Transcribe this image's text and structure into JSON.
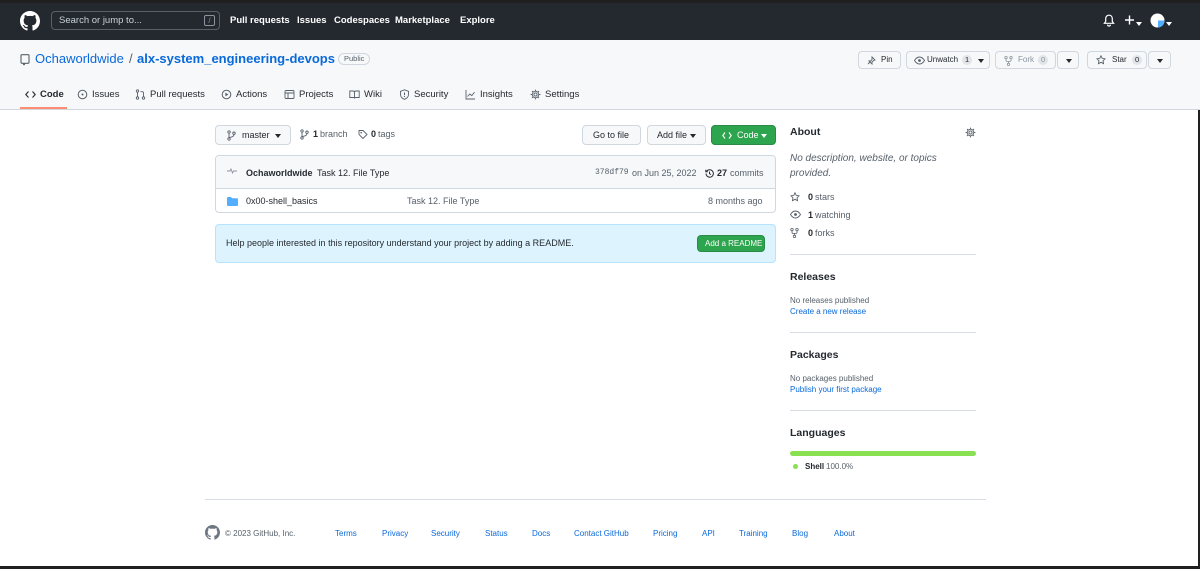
{
  "header": {
    "search_placeholder": "Search or jump to...",
    "slash_hint": "/",
    "nav": [
      "Pull requests",
      "Issues",
      "Codespaces",
      "Marketplace",
      "Explore"
    ],
    "plus_label": "+",
    "icons": [
      "github-logo",
      "bell-icon",
      "plus-icon",
      "avatar"
    ]
  },
  "repo": {
    "owner": "Ochaworldwide",
    "separator": "/",
    "name": "alx-system_engineering-devops",
    "visibility": "Public",
    "pin_label": "Pin",
    "unwatch_label": "Unwatch",
    "watch_count": "1",
    "fork_label": "Fork",
    "fork_count": "0",
    "star_label": "Star",
    "star_count": "0"
  },
  "tabs": [
    {
      "label": "Code",
      "icon": "code-icon",
      "selected": true
    },
    {
      "label": "Issues",
      "icon": "issue-icon"
    },
    {
      "label": "Pull requests",
      "icon": "pull-request-icon"
    },
    {
      "label": "Actions",
      "icon": "play-icon"
    },
    {
      "label": "Projects",
      "icon": "table-icon"
    },
    {
      "label": "Wiki",
      "icon": "book-icon"
    },
    {
      "label": "Security",
      "icon": "shield-icon"
    },
    {
      "label": "Insights",
      "icon": "graph-icon"
    },
    {
      "label": "Settings",
      "icon": "gear-icon"
    }
  ],
  "toolbar": {
    "branch": "master",
    "branch_count": "1",
    "branch_word": "branch",
    "tag_count": "0",
    "tag_word": "tags",
    "goto_file": "Go to file",
    "add_file": "Add file",
    "code": "Code"
  },
  "commit": {
    "author": "Ochaworldwide",
    "message": "Task 12. File Type",
    "sha": "378df79",
    "date": "on Jun 25, 2022",
    "count": "27",
    "count_word": "commits"
  },
  "files": [
    {
      "name": "0x00-shell_basics",
      "message": "Task 12. File Type",
      "age": "8 months ago",
      "type": "folder"
    }
  ],
  "readme_banner": {
    "text": "Help people interested in this repository understand your project by adding a README.",
    "button": "Add a README"
  },
  "sidebar": {
    "about_title": "About",
    "description": "No description, website, or topics provided.",
    "stars_count": "0",
    "stars_word": "stars",
    "watching_count": "1",
    "watching_word": "watching",
    "forks_count": "0",
    "forks_word": "forks",
    "releases_title": "Releases",
    "releases_text": "No releases published",
    "releases_link": "Create a new release",
    "packages_title": "Packages",
    "packages_text": "No packages published",
    "packages_link": "Publish your first package",
    "languages_title": "Languages",
    "language_name": "Shell",
    "language_percent": "100.0%",
    "language_fraction": 1.0
  },
  "footer": {
    "copyright": "© 2023 GitHub, Inc.",
    "links": [
      "Terms",
      "Privacy",
      "Security",
      "Status",
      "Docs",
      "Contact GitHub",
      "Pricing",
      "API",
      "Training",
      "Blog",
      "About"
    ]
  },
  "colors": {
    "header_bg": "#24292f",
    "link": "#0969da",
    "green_button": "#2da44e",
    "shell_language": "#89e051",
    "tab_underline": "#fd8c73",
    "readme_bg": "#ddf4ff"
  }
}
